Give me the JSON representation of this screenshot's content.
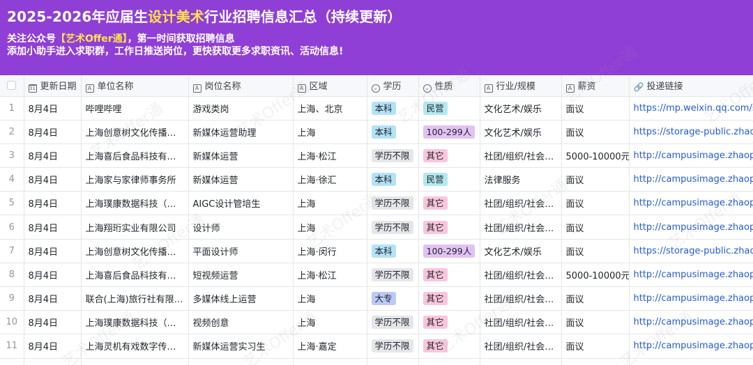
{
  "banner": {
    "title_pre": "2025-2026年应届生",
    "title_highlight": "设计美术",
    "title_post": "行业招聘信息汇总（持续更新）",
    "line1_pre": "关注公众号",
    "line1_highlight": "【艺术Offer通】",
    "line1_post": "，第一时间获取招聘信息",
    "line2": "添加小助手进入求职群，工作日推送岗位，更快获取更多求职资讯、活动信息!"
  },
  "columns": [
    {
      "label": "更新日期",
      "icon": "calendar-icon"
    },
    {
      "label": "单位名称",
      "icon": "text-field-icon"
    },
    {
      "label": "岗位名称",
      "icon": "text-field-icon"
    },
    {
      "label": "区域",
      "icon": "text-field-icon"
    },
    {
      "label": "学历",
      "icon": "single-select-icon"
    },
    {
      "label": "性质",
      "icon": "single-select-icon"
    },
    {
      "label": "行业/规模",
      "icon": "text-field-icon"
    },
    {
      "label": "薪资",
      "icon": "text-field-icon"
    },
    {
      "label": "投递链接",
      "icon": "link-icon"
    }
  ],
  "rows": [
    {
      "index": "1",
      "date": "8月4日",
      "company": "哔哩哔哩",
      "position": "游戏类岗",
      "region": "上海、北京",
      "edu": "本科",
      "nature": "民营",
      "industry": "文化艺术/娱乐",
      "salary": "面议",
      "link": "https://mp.weixin.qq.com/s/v"
    },
    {
      "index": "2",
      "date": "8月4日",
      "company": "上海创意树文化传播有…",
      "position": "新媒体运营助理",
      "region": "上海",
      "edu": "本科",
      "nature": "100-299人",
      "industry": "文化艺术/娱乐",
      "salary": "面议",
      "link": "https://storage-public.zhaopin"
    },
    {
      "index": "3",
      "date": "8月4日",
      "company": "上海喜后食品科技有限…",
      "position": "新媒体运营",
      "region": "上海·松江",
      "edu": "学历不限",
      "nature": "其它",
      "industry": "社团/组织/社会…",
      "salary": "5000-10000元",
      "link": "http://campusimage.zhaopin"
    },
    {
      "index": "4",
      "date": "8月4日",
      "company": "上海家与家律师事务所",
      "position": "新媒体运营",
      "region": "上海·徐汇",
      "edu": "本科",
      "nature": "民营",
      "industry": "法律服务",
      "salary": "面议",
      "link": "http://campusimage.zhaopin"
    },
    {
      "index": "5",
      "date": "8月4日",
      "company": "上海璞康数据科技（集…",
      "position": "AIGC设计管培生",
      "region": "上海",
      "edu": "学历不限",
      "nature": "其它",
      "industry": "社团/组织/社会…",
      "salary": "面议",
      "link": "http://campusimage.zhaopin"
    },
    {
      "index": "6",
      "date": "8月4日",
      "company": "上海翔珩实业有限公司",
      "position": "设计师",
      "region": "上海",
      "edu": "学历不限",
      "nature": "其它",
      "industry": "社团/组织/社会…",
      "salary": "面议",
      "link": "http://campusimage.zhaopin"
    },
    {
      "index": "7",
      "date": "8月4日",
      "company": "上海创意树文化传播有…",
      "position": "平面设计师",
      "region": "上海·闵行",
      "edu": "本科",
      "nature": "100-299人",
      "industry": "文化艺术/娱乐",
      "salary": "面议",
      "link": "https://storage-public.zhaopi"
    },
    {
      "index": "8",
      "date": "8月4日",
      "company": "上海喜后食品科技有限…",
      "position": "短视频运营",
      "region": "上海·松江",
      "edu": "学历不限",
      "nature": "其它",
      "industry": "社团/组织/社会…",
      "salary": "5000-10000元",
      "link": "http://campusimage.zhaopin"
    },
    {
      "index": "9",
      "date": "8月4日",
      "company": "联合(上海)旅行社有限…",
      "position": "多媒体线上运营",
      "region": "上海",
      "edu": "大专",
      "nature": "其它",
      "industry": "社团/组织/社会…",
      "salary": "面议",
      "link": "http://campusimage.zhaopin"
    },
    {
      "index": "10",
      "date": "8月4日",
      "company": "上海璞康数据科技（集…",
      "position": "视频创意",
      "region": "上海",
      "edu": "学历不限",
      "nature": "其它",
      "industry": "社团/组织/社会…",
      "salary": "面议",
      "link": "http://campusimage.zhaopin"
    },
    {
      "index": "11",
      "date": "8月4日",
      "company": "上海灵机有戏数字传媒…",
      "position": "新媒体运营实习生",
      "region": "上海·嘉定",
      "edu": "学历不限",
      "nature": "其它",
      "industry": "社团/组织/社会…",
      "salary": "面议",
      "link": "http://campusimage.zhaopin"
    }
  ],
  "watermark_text": "艺术Offer通",
  "colors": {
    "banner": "#8f3fd6",
    "highlight": "#ffe14d",
    "link": "#245bdb"
  }
}
